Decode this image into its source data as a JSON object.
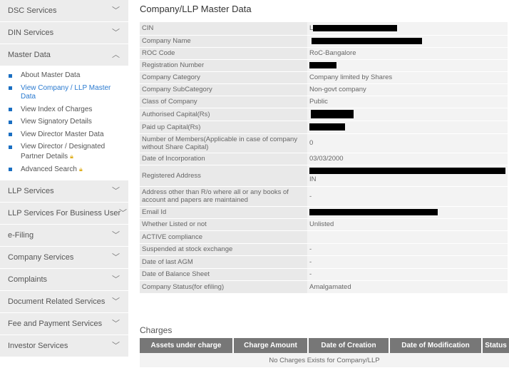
{
  "sidebar": {
    "items_top": [
      {
        "label": "DSC Services"
      },
      {
        "label": "DIN Services"
      }
    ],
    "master_data": {
      "label": "Master Data",
      "subitems": [
        {
          "label": "About Master Data"
        },
        {
          "label": "View Company / LLP Master Data",
          "active": true
        },
        {
          "label": "View Index of Charges"
        },
        {
          "label": "View Signatory Details"
        },
        {
          "label": "View Director Master Data"
        },
        {
          "label": "View Director / Designated Partner Details",
          "locked": true
        },
        {
          "label": "Advanced Search",
          "locked": true
        }
      ]
    },
    "items_bottom": [
      {
        "label": "LLP Services"
      },
      {
        "label": "LLP Services For Business User"
      },
      {
        "label": "e-Filing"
      },
      {
        "label": "Company Services"
      },
      {
        "label": "Complaints"
      },
      {
        "label": "Document Related Services"
      },
      {
        "label": "Fee and Payment Services"
      },
      {
        "label": "Investor Services"
      }
    ]
  },
  "main": {
    "title": "Company/LLP Master Data",
    "rows": [
      {
        "key": "CIN",
        "value": "L"
      },
      {
        "key": "Company Name",
        "value": ""
      },
      {
        "key": "ROC Code",
        "value": "RoC-Bangalore"
      },
      {
        "key": "Registration Number",
        "value": ""
      },
      {
        "key": "Company Category",
        "value": "Company limited by Shares"
      },
      {
        "key": "Company SubCategory",
        "value": "Non-govt company"
      },
      {
        "key": "Class of Company",
        "value": "Public"
      },
      {
        "key": "Authorised Capital(Rs)",
        "value": ""
      },
      {
        "key": "Paid up Capital(Rs)",
        "value": ""
      },
      {
        "key": "Number of Members(Applicable in case of company without Share Capital)",
        "value": "0"
      },
      {
        "key": "Date of Incorporation",
        "value": "03/03/2000"
      },
      {
        "key": "Registered Address",
        "value": "IN"
      },
      {
        "key": "Address other than R/o where all or any books of account and papers are maintained",
        "value": "-"
      },
      {
        "key": "Email Id",
        "value": ""
      },
      {
        "key": "Whether Listed or not",
        "value": "Unlisted"
      },
      {
        "key": "ACTIVE compliance",
        "value": ""
      },
      {
        "key": "Suspended at stock exchange",
        "value": "-"
      },
      {
        "key": "Date of last AGM",
        "value": "-"
      },
      {
        "key": "Date of Balance Sheet",
        "value": "-"
      },
      {
        "key": "Company Status(for efiling)",
        "value": "Amalgamated"
      }
    ],
    "charges": {
      "title": "Charges",
      "headers": [
        "Assets under charge",
        "Charge Amount",
        "Date of Creation",
        "Date of Modification",
        "Status"
      ],
      "empty_message": "No Charges Exists for Company/LLP"
    }
  },
  "icons": {
    "chevron_down": "chevron-down-icon",
    "chevron_up": "chevron-up-icon",
    "bullet": "square-bullet-icon",
    "lock": "lock-icon"
  },
  "colors": {
    "sidebar_bg": "#ececec",
    "accent_blue": "#1a6fc2",
    "header_bg": "#777777",
    "lock": "#e0b020"
  }
}
